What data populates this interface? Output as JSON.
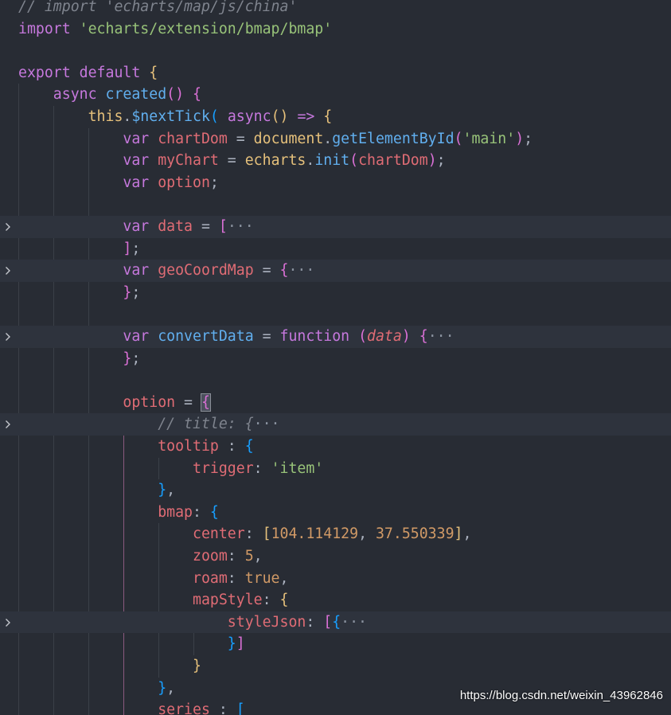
{
  "colors": {
    "background": "#282c34",
    "fold_line_bg": "#2e333d",
    "keyword": "#c678dd",
    "variable": "#e06c75",
    "function": "#61afef",
    "string": "#98c379",
    "number": "#d19a66",
    "plain": "#abb2bf",
    "comment": "#7f848e",
    "bracket_gold": "#e5c07b",
    "bracket_pink": "#da70d6",
    "bracket_blue": "#179fff"
  },
  "lines": [
    {
      "fold": false,
      "tokens": [
        {
          "t": "// import 'echarts/map/js/china'",
          "c": "comment"
        }
      ]
    },
    {
      "fold": false,
      "tokens": [
        {
          "t": "import ",
          "c": "keyword"
        },
        {
          "t": "'echarts/extension/bmap/bmap'",
          "c": "string"
        }
      ]
    },
    {
      "fold": false,
      "tokens": []
    },
    {
      "fold": false,
      "tokens": [
        {
          "t": "export ",
          "c": "keyword"
        },
        {
          "t": "default ",
          "c": "keyword"
        },
        {
          "t": "{",
          "c": "bracket_gold"
        }
      ]
    },
    {
      "fold": false,
      "tokens": [
        {
          "t": "    async ",
          "c": "keyword"
        },
        {
          "t": "created",
          "c": "function"
        },
        {
          "t": "() ",
          "c": "bracket_pink"
        },
        {
          "t": "{",
          "c": "bracket_pink"
        }
      ]
    },
    {
      "fold": false,
      "tokens": [
        {
          "t": "        this",
          "c": "bracket_gold"
        },
        {
          "t": ".",
          "c": "plain"
        },
        {
          "t": "$nextTick",
          "c": "function"
        },
        {
          "t": "( ",
          "c": "bracket_blue"
        },
        {
          "t": "async",
          "c": "keyword"
        },
        {
          "t": "() ",
          "c": "bracket_gold"
        },
        {
          "t": "=> ",
          "c": "keyword"
        },
        {
          "t": "{",
          "c": "bracket_gold"
        }
      ]
    },
    {
      "fold": false,
      "tokens": [
        {
          "t": "            var ",
          "c": "keyword"
        },
        {
          "t": "chartDom",
          "c": "variable"
        },
        {
          "t": " = ",
          "c": "plain"
        },
        {
          "t": "document",
          "c": "bracket_gold"
        },
        {
          "t": ".",
          "c": "plain"
        },
        {
          "t": "getElementById",
          "c": "function"
        },
        {
          "t": "(",
          "c": "bracket_pink"
        },
        {
          "t": "'main'",
          "c": "string"
        },
        {
          "t": ")",
          "c": "bracket_pink"
        },
        {
          "t": ";",
          "c": "plain"
        }
      ]
    },
    {
      "fold": false,
      "tokens": [
        {
          "t": "            var ",
          "c": "keyword"
        },
        {
          "t": "myChart",
          "c": "variable"
        },
        {
          "t": " = ",
          "c": "plain"
        },
        {
          "t": "echarts",
          "c": "bracket_gold"
        },
        {
          "t": ".",
          "c": "plain"
        },
        {
          "t": "init",
          "c": "function"
        },
        {
          "t": "(",
          "c": "bracket_pink"
        },
        {
          "t": "chartDom",
          "c": "variable"
        },
        {
          "t": ")",
          "c": "bracket_pink"
        },
        {
          "t": ";",
          "c": "plain"
        }
      ]
    },
    {
      "fold": false,
      "tokens": [
        {
          "t": "            var ",
          "c": "keyword"
        },
        {
          "t": "option",
          "c": "variable"
        },
        {
          "t": ";",
          "c": "plain"
        }
      ]
    },
    {
      "fold": false,
      "tokens": []
    },
    {
      "fold": true,
      "tokens": [
        {
          "t": "            var ",
          "c": "keyword"
        },
        {
          "t": "data",
          "c": "variable"
        },
        {
          "t": " = ",
          "c": "plain"
        },
        {
          "t": "[",
          "c": "bracket_pink"
        },
        {
          "t": "···",
          "c": "ellipsis"
        }
      ]
    },
    {
      "fold": false,
      "tokens": [
        {
          "t": "            ]",
          "c": "bracket_pink"
        },
        {
          "t": ";",
          "c": "plain"
        }
      ]
    },
    {
      "fold": true,
      "tokens": [
        {
          "t": "            var ",
          "c": "keyword"
        },
        {
          "t": "geoCoordMap",
          "c": "variable"
        },
        {
          "t": " = ",
          "c": "plain"
        },
        {
          "t": "{",
          "c": "bracket_pink"
        },
        {
          "t": "···",
          "c": "ellipsis"
        }
      ]
    },
    {
      "fold": false,
      "tokens": [
        {
          "t": "            }",
          "c": "bracket_pink"
        },
        {
          "t": ";",
          "c": "plain"
        }
      ]
    },
    {
      "fold": false,
      "tokens": []
    },
    {
      "fold": true,
      "tokens": [
        {
          "t": "            var ",
          "c": "keyword"
        },
        {
          "t": "convertData",
          "c": "function"
        },
        {
          "t": " = ",
          "c": "plain"
        },
        {
          "t": "function ",
          "c": "keyword"
        },
        {
          "t": "(",
          "c": "bracket_pink"
        },
        {
          "t": "data",
          "c": "variable_italic"
        },
        {
          "t": ") ",
          "c": "bracket_pink"
        },
        {
          "t": "{",
          "c": "bracket_pink"
        },
        {
          "t": "···",
          "c": "ellipsis"
        }
      ]
    },
    {
      "fold": false,
      "tokens": [
        {
          "t": "            }",
          "c": "bracket_pink"
        },
        {
          "t": ";",
          "c": "plain"
        }
      ]
    },
    {
      "fold": false,
      "tokens": []
    },
    {
      "fold": false,
      "tokens": [
        {
          "t": "            option",
          "c": "variable"
        },
        {
          "t": " = ",
          "c": "plain"
        },
        {
          "t": "{",
          "c": "bracket_pink_hl"
        }
      ]
    },
    {
      "fold": true,
      "tokens": [
        {
          "t": "                // title: ",
          "c": "comment_italic"
        },
        {
          "t": "{",
          "c": "comment_italic"
        },
        {
          "t": "···",
          "c": "ellipsis"
        }
      ]
    },
    {
      "fold": false,
      "tokens": [
        {
          "t": "                tooltip",
          "c": "variable"
        },
        {
          "t": " : ",
          "c": "plain"
        },
        {
          "t": "{",
          "c": "bracket_blue"
        }
      ]
    },
    {
      "fold": false,
      "tokens": [
        {
          "t": "                    trigger",
          "c": "variable"
        },
        {
          "t": ": ",
          "c": "plain"
        },
        {
          "t": "'item'",
          "c": "string"
        }
      ]
    },
    {
      "fold": false,
      "tokens": [
        {
          "t": "                }",
          "c": "bracket_blue"
        },
        {
          "t": ",",
          "c": "plain"
        }
      ]
    },
    {
      "fold": false,
      "tokens": [
        {
          "t": "                bmap",
          "c": "variable"
        },
        {
          "t": ": ",
          "c": "plain"
        },
        {
          "t": "{",
          "c": "bracket_blue"
        }
      ]
    },
    {
      "fold": false,
      "tokens": [
        {
          "t": "                    center",
          "c": "variable"
        },
        {
          "t": ": ",
          "c": "plain"
        },
        {
          "t": "[",
          "c": "bracket_gold"
        },
        {
          "t": "104.114129",
          "c": "number"
        },
        {
          "t": ", ",
          "c": "plain"
        },
        {
          "t": "37.550339",
          "c": "number"
        },
        {
          "t": "]",
          "c": "bracket_gold"
        },
        {
          "t": ",",
          "c": "plain"
        }
      ]
    },
    {
      "fold": false,
      "tokens": [
        {
          "t": "                    zoom",
          "c": "variable"
        },
        {
          "t": ": ",
          "c": "plain"
        },
        {
          "t": "5",
          "c": "number"
        },
        {
          "t": ",",
          "c": "plain"
        }
      ]
    },
    {
      "fold": false,
      "tokens": [
        {
          "t": "                    roam",
          "c": "variable"
        },
        {
          "t": ": ",
          "c": "plain"
        },
        {
          "t": "true",
          "c": "number"
        },
        {
          "t": ",",
          "c": "plain"
        }
      ]
    },
    {
      "fold": false,
      "tokens": [
        {
          "t": "                    mapStyle",
          "c": "variable"
        },
        {
          "t": ": ",
          "c": "plain"
        },
        {
          "t": "{",
          "c": "bracket_gold"
        }
      ]
    },
    {
      "fold": true,
      "tokens": [
        {
          "t": "                        styleJson",
          "c": "variable"
        },
        {
          "t": ": ",
          "c": "plain"
        },
        {
          "t": "[",
          "c": "bracket_pink"
        },
        {
          "t": "{",
          "c": "bracket_blue"
        },
        {
          "t": "···",
          "c": "ellipsis"
        }
      ]
    },
    {
      "fold": false,
      "tokens": [
        {
          "t": "                        }",
          "c": "bracket_blue"
        },
        {
          "t": "]",
          "c": "bracket_pink"
        }
      ]
    },
    {
      "fold": false,
      "tokens": [
        {
          "t": "                    }",
          "c": "bracket_gold"
        }
      ]
    },
    {
      "fold": false,
      "tokens": [
        {
          "t": "                }",
          "c": "bracket_blue"
        },
        {
          "t": ",",
          "c": "plain"
        }
      ]
    },
    {
      "fold": false,
      "tokens": [
        {
          "t": "                series",
          "c": "variable"
        },
        {
          "t": " : ",
          "c": "plain"
        },
        {
          "t": "[",
          "c": "bracket_blue"
        }
      ]
    }
  ],
  "watermark": "https://blog.csdn.net/weixin_43962846"
}
